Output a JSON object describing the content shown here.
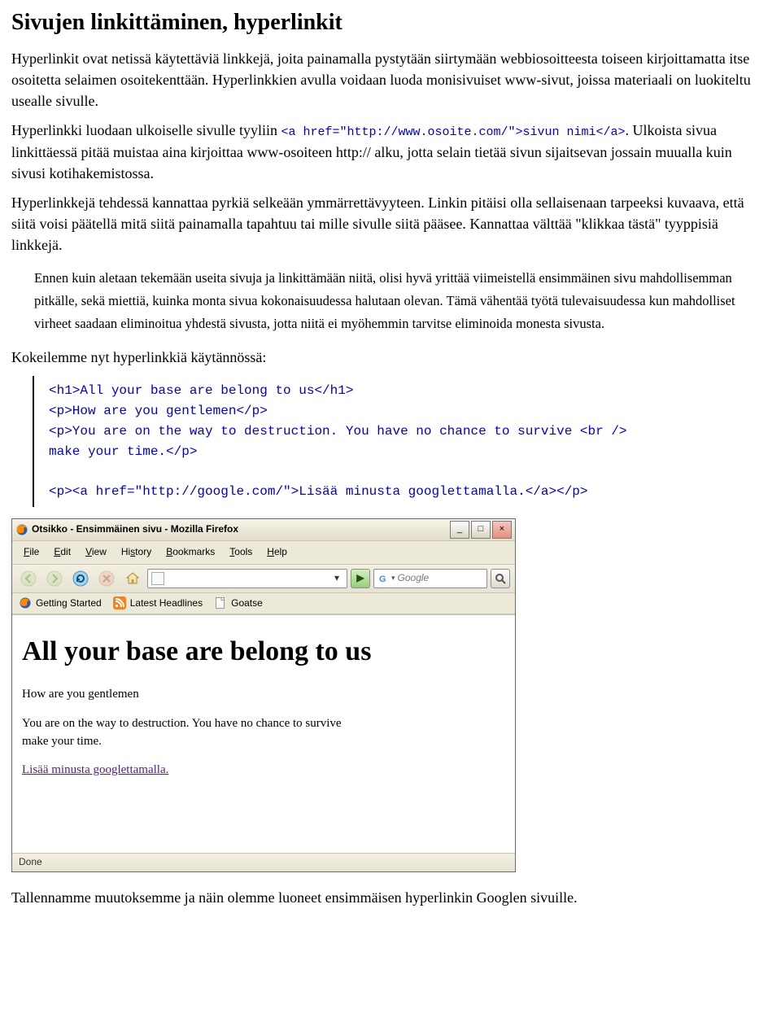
{
  "heading": "Sivujen linkittäminen, hyperlinkit",
  "para1a": "Hyperlinkit ovat netissä käytettäviä linkkejä, joita painamalla pystytään siirtymään webbiosoitteesta toiseen kirjoittamatta itse osoitetta selaimen osoitekenttään. Hyperlinkkien avulla voidaan luoda monisivuiset www-sivut, joissa materiaali on luokiteltu usealle sivulle.",
  "para1b": "Hyperlinkki luodaan ulkoiselle sivulle tyyliin ",
  "code1": "<a href=\"http://www.osoite.com/\">sivun nimi</a>",
  "para1c": ". Ulkoista sivua linkittäessä pitää muistaa aina kirjoittaa www-osoiteen http:// alku, jotta selain tietää sivun sijaitsevan jossain muualla kuin sivusi kotihakemistossa.",
  "para2": "Hyperlinkkejä tehdessä kannattaa pyrkiä selkeään ymmärrettävyyteen. Linkin pitäisi olla sellaisenaan tarpeeksi kuvaava, että siitä voisi päätellä mitä siitä painamalla tapahtuu tai mille sivulle siitä pääsee. Kannattaa välttää \"klikkaa tästä\" tyyppisiä linkkejä.",
  "note": "Ennen kuin aletaan tekemään useita sivuja ja linkittämään niitä, olisi hyvä yrittää viimeistellä ensimmäinen sivu mahdollisemman pitkälle, sekä miettiä, kuinka monta sivua kokonaisuudessa halutaan olevan. Tämä vähentää työtä tulevaisuudessa kun mahdolliset virheet saadaan eliminoitua yhdestä sivusta, jotta niitä ei myöhemmin tarvitse eliminoida monesta sivusta.",
  "para3": "Kokeilemme nyt hyperlinkkiä käytännössä:",
  "codeblock": "<h1>All your base are belong to us</h1>\n<p>How are you gentlemen</p>\n<p>You are on the way to destruction. You have no chance to survive <br />\nmake your time.</p>\n\n<p><a href=\"http://google.com/\">Lisää minusta googlettamalla.</a></p>",
  "browser": {
    "title": "Otsikko - Ensimmäinen sivu - Mozilla Firefox",
    "menus": [
      "File",
      "Edit",
      "View",
      "History",
      "Bookmarks",
      "Tools",
      "Help"
    ],
    "search_placeholder": "Google",
    "bookmarks": [
      "Getting Started",
      "Latest Headlines",
      "Goatse"
    ],
    "content": {
      "h1": "All your base are belong to us",
      "p1": "How are you gentlemen",
      "p2a": "You are on the way to destruction. You have no chance to survive",
      "p2b": "make your time.",
      "link": "Lisää minusta googlettamalla."
    },
    "status": "Done"
  },
  "para4": "Tallennamme muutoksemme ja näin olemme luoneet ensimmäisen hyperlinkin Googlen sivuille."
}
